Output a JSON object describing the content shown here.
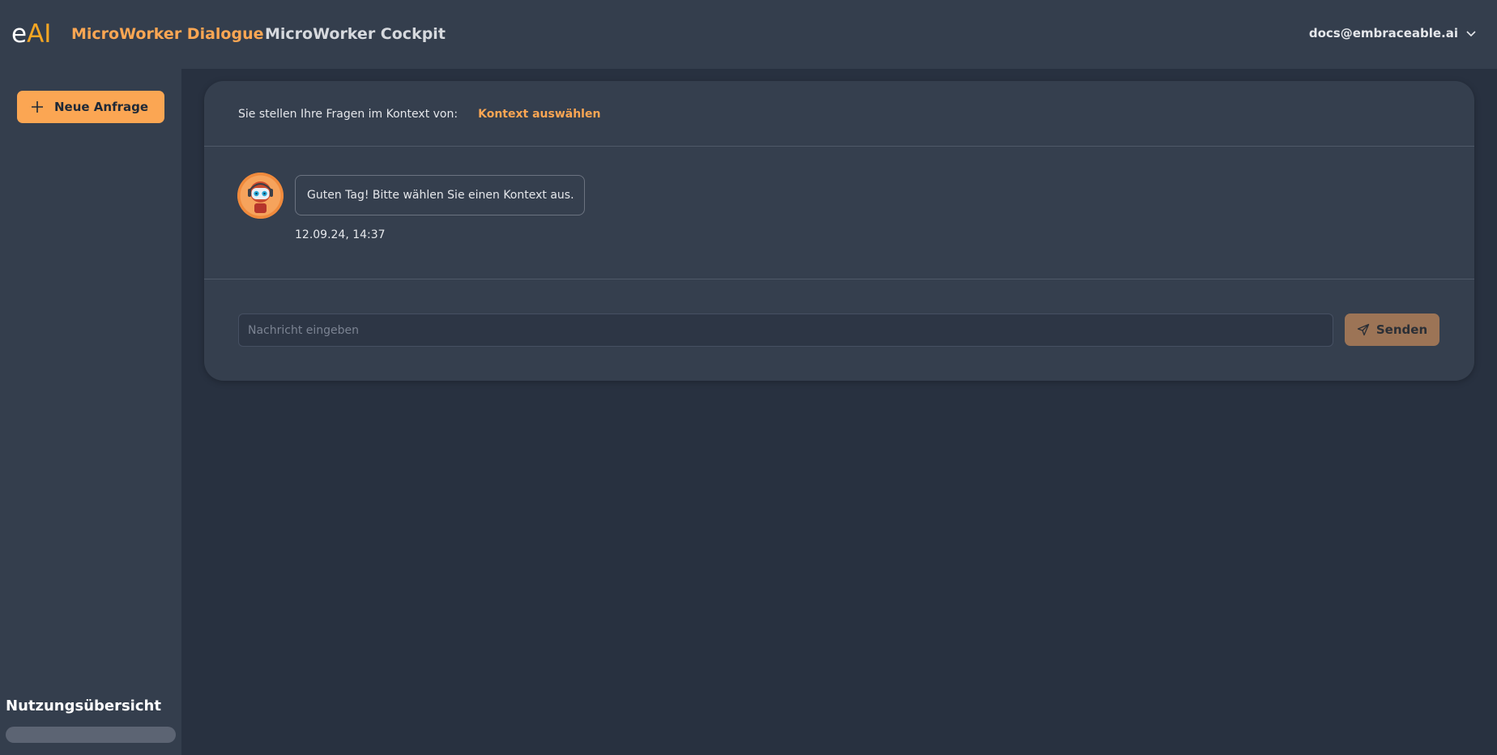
{
  "header": {
    "logo_e": "e",
    "logo_ai": "AI",
    "nav": [
      {
        "label": "MicroWorker Dialogue",
        "active": true
      },
      {
        "label": "MicroWorker Cockpit",
        "active": false
      }
    ],
    "user_email": "docs@embraceable.ai"
  },
  "sidebar": {
    "new_request_label": "Neue Anfrage",
    "usage_title": "Nutzungsübersicht"
  },
  "chat": {
    "context_prefix": "Sie stellen Ihre Fragen im Kontext von:",
    "context_link": "Kontext auswählen",
    "messages": [
      {
        "text": "Guten Tag! Bitte wählen Sie einen Kontext aus.",
        "timestamp": "12.09.24, 14:37"
      }
    ],
    "input_placeholder": "Nachricht eingeben",
    "send_label": "Senden"
  },
  "colors": {
    "accent": "#fba653",
    "background": "#283140",
    "panel": "#353f4e"
  }
}
